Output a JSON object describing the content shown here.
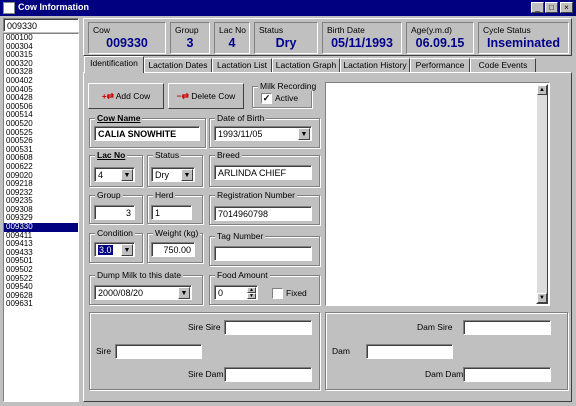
{
  "window": {
    "title": "Cow Information",
    "min": "_",
    "max": "□",
    "close": "×"
  },
  "search": {
    "value": "009330"
  },
  "cows": [
    "000100",
    "000304",
    "000315",
    "000320",
    "000328",
    "000402",
    "000405",
    "000428",
    "000506",
    "000514",
    "000520",
    "000525",
    "000526",
    "000531",
    "000608",
    "000622",
    "009020",
    "009218",
    "009232",
    "009235",
    "009308",
    "009329",
    "009330",
    "009411",
    "009413",
    "009433",
    "009501",
    "009502",
    "009522",
    "009540",
    "009628",
    "009631"
  ],
  "selected_cow": "009330",
  "header": {
    "cow_label": "Cow",
    "cow": "009330",
    "group_label": "Group",
    "group": "3",
    "lacno_label": "Lac No",
    "lacno": "4",
    "status_label": "Status",
    "status": "Dry",
    "birth_label": "Birth Date",
    "birth": "05/11/1993",
    "age_label": "Age(y.m.d)",
    "age": "06.09.15",
    "cycle_label": "Cycle Status",
    "cycle": "Inseminated"
  },
  "tabs": [
    "Identification",
    "Lactation Dates",
    "Lactation List",
    "Lactation Graph",
    "Lactation History",
    "Performance",
    "Code Events"
  ],
  "buttons": {
    "add_cow": "Add Cow",
    "delete_cow": "Delete Cow"
  },
  "milk_recording": {
    "label": "Milk Recording",
    "active_label": "Active",
    "active": true
  },
  "form": {
    "cow_name_label": "Cow Name",
    "cow_name": "CALIA SNOWHITE",
    "dob_label": "Date of Birth",
    "dob": "1993/11/05",
    "lacno_label": "Lac No",
    "lacno": "4",
    "status_label": "Status",
    "status": "Dry",
    "breed_label": "Breed",
    "breed": "ARLINDA CHIEF",
    "group_label": "Group",
    "group": "3",
    "herd_label": "Herd",
    "herd": "1",
    "reg_label": "Registration Number",
    "reg": "7014960798",
    "condition_label": "Condition",
    "condition": "3.0",
    "weight_label": "Weight (kg)",
    "weight": "750.00",
    "tag_label": "Tag Number",
    "tag": "",
    "dump_label": "Dump Milk to this date",
    "dump": "2000/08/20",
    "food_label": "Food Amount",
    "food": "0",
    "fixed_label": "Fixed"
  },
  "pedigree": {
    "sire_sire": "Sire Sire",
    "sire": "Sire",
    "sire_dam": "Sire Dam",
    "dam_sire": "Dam Sire",
    "dam": "Dam",
    "dam_dam": "Dam Dam"
  }
}
